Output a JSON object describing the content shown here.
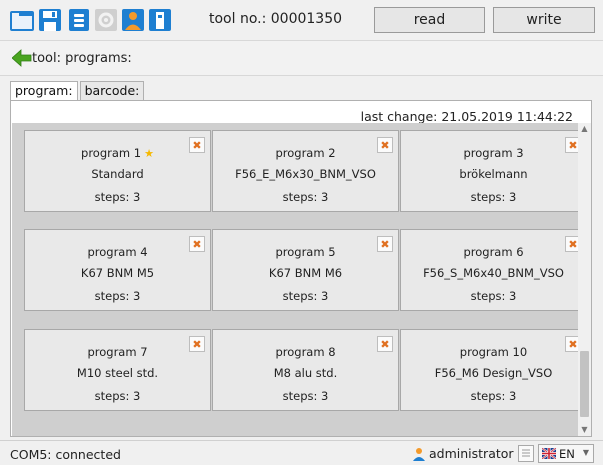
{
  "toolbar": {
    "icons": [
      "folder-icon",
      "save-icon",
      "database-icon",
      "settings-icon",
      "user-icon",
      "usb-device-icon"
    ],
    "tool_no": "tool no.: 00001350",
    "read_label": "read",
    "write_label": "write"
  },
  "breadcrumb": {
    "back_icon": "green-back-arrow-icon",
    "label": "tool: programs:"
  },
  "tabs": [
    {
      "label": "program:",
      "active": true
    },
    {
      "label": "barcode:",
      "active": false
    }
  ],
  "last_change": "last change:  21.05.2019  11:44:22",
  "programs": [
    {
      "name": "program 1",
      "desc": "Standard",
      "steps": "steps: 3",
      "default": true
    },
    {
      "name": "program 2",
      "desc": "F56_E_M6x30_BNM_VSO",
      "steps": "steps: 3",
      "default": false
    },
    {
      "name": "program 3",
      "desc": "brökelmann",
      "steps": "steps: 3",
      "default": false
    },
    {
      "name": "program 4",
      "desc": "K67 BNM M5",
      "steps": "steps: 3",
      "default": false
    },
    {
      "name": "program 5",
      "desc": "K67 BNM M6",
      "steps": "steps: 3",
      "default": false
    },
    {
      "name": "program 6",
      "desc": "F56_S_M6x40_BNM_VSO",
      "steps": "steps: 3",
      "default": false
    },
    {
      "name": "program 7",
      "desc": "M10 steel std.",
      "steps": "steps: 3",
      "default": false
    },
    {
      "name": "program 8",
      "desc": "M8 alu std.",
      "steps": "steps: 3",
      "default": false
    },
    {
      "name": "program 10",
      "desc": "F56_M6 Design_VSO",
      "steps": "steps: 3",
      "default": false
    }
  ],
  "delete_glyph": "✖",
  "star_glyph": "★",
  "status": {
    "connection": "COM5: connected",
    "user": "administrator",
    "language": "EN"
  },
  "colors": {
    "accent_orange": "#e07020",
    "star_yellow": "#f5b800",
    "blue_icon": "#1e7fd1",
    "grid_bg": "#cfcfcf"
  }
}
